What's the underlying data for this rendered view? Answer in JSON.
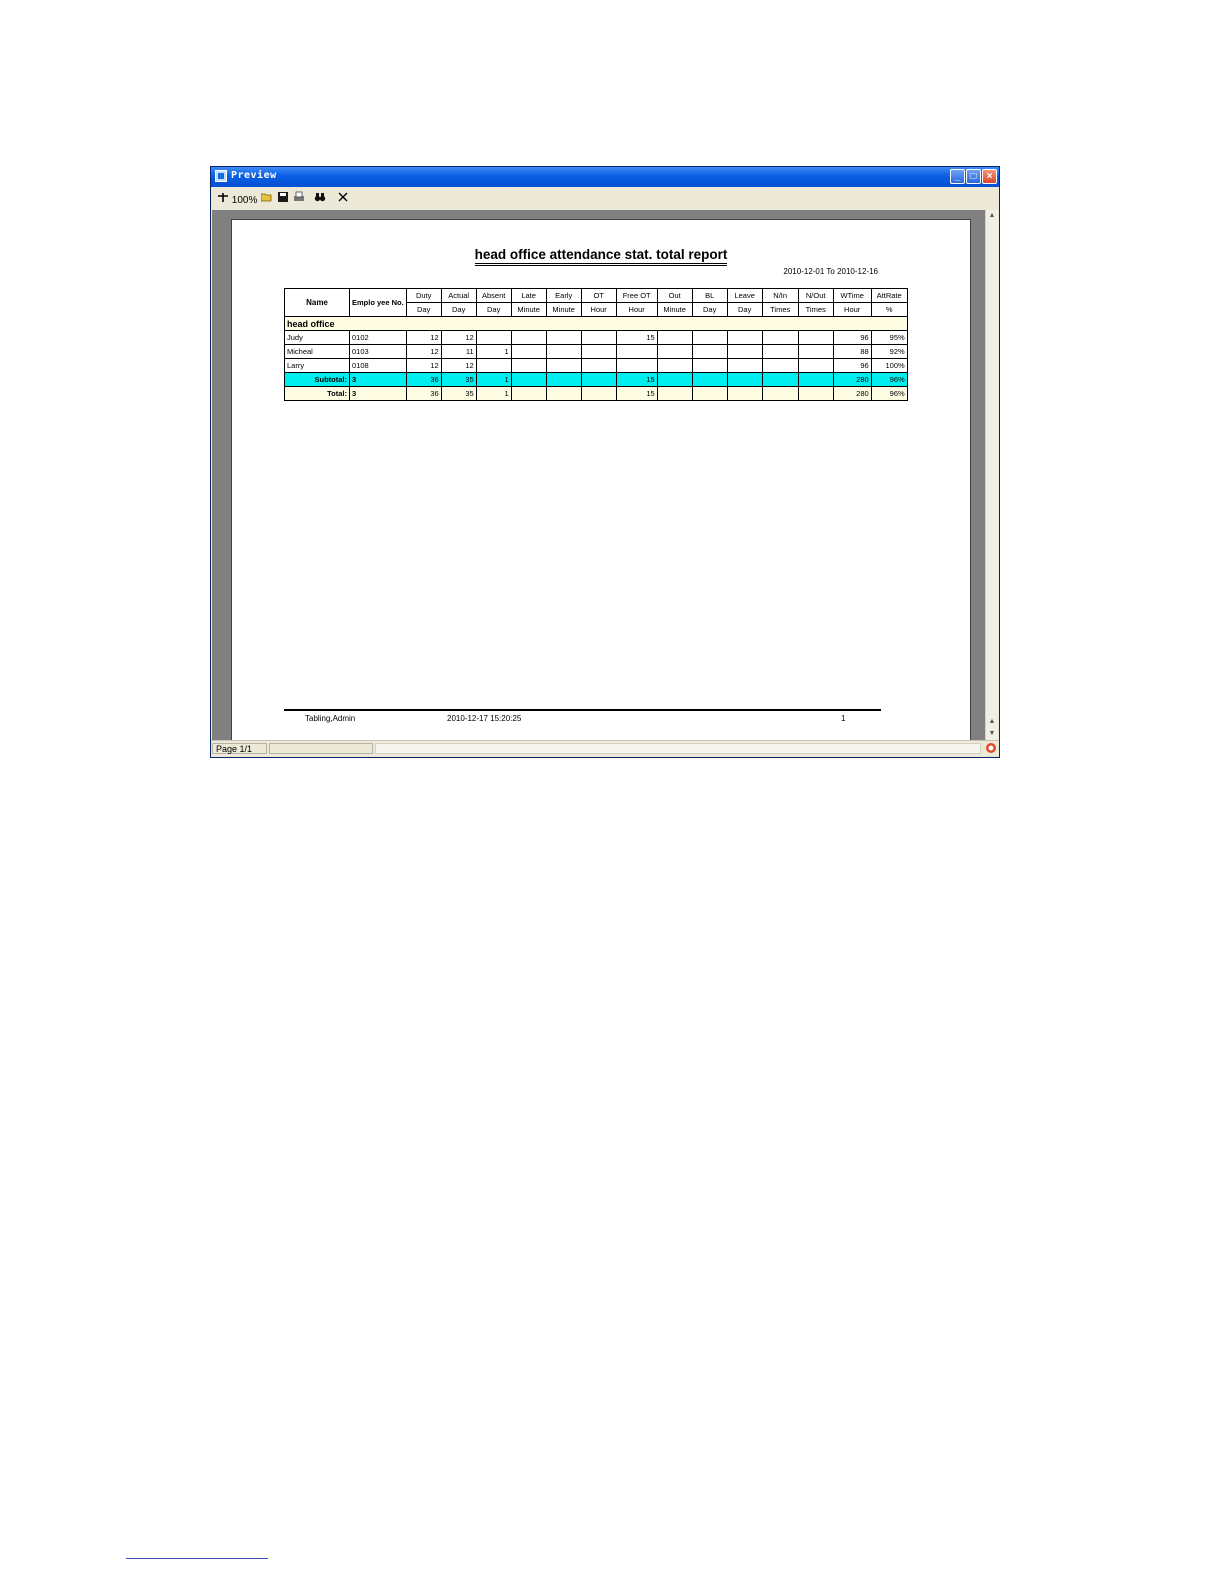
{
  "window": {
    "title": "Preview"
  },
  "toolbar": {
    "zoom_label": "100%"
  },
  "status": {
    "page": "Page 1/1"
  },
  "report": {
    "title": "head office attendance stat. total report",
    "date_range": "2010-12-01 To 2010-12-16",
    "header_top": [
      "Name",
      "Emplo yee No.",
      "Duty",
      "Actual",
      "Absent",
      "Late",
      "Early",
      "OT",
      "Free OT",
      "Out",
      "BL",
      "Leave",
      "N/In",
      "N/Out",
      "WTime",
      "AttRate"
    ],
    "header_units": [
      "Day",
      "Day",
      "Day",
      "Minute",
      "Minute",
      "Hour",
      "Hour",
      "Minute",
      "Day",
      "Day",
      "Times",
      "Times",
      "Hour",
      "%"
    ],
    "group": "head office",
    "rows": [
      {
        "name": "Judy",
        "no": "0102",
        "cells": [
          "12",
          "12",
          "",
          "",
          "",
          "",
          "15",
          "",
          "",
          "",
          "",
          "",
          "96",
          "95%"
        ]
      },
      {
        "name": "Micheal",
        "no": "0103",
        "cells": [
          "12",
          "11",
          "1",
          "",
          "",
          "",
          "",
          "",
          "",
          "",
          "",
          "",
          "88",
          "92%"
        ]
      },
      {
        "name": "Larry",
        "no": "0108",
        "cells": [
          "12",
          "12",
          "",
          "",
          "",
          "",
          "",
          "",
          "",
          "",
          "",
          "",
          "96",
          "100%"
        ]
      }
    ],
    "subtotal": {
      "label": "Subtotal:",
      "count": "3",
      "cells": [
        "36",
        "35",
        "1",
        "",
        "",
        "",
        "15",
        "",
        "",
        "",
        "",
        "",
        "280",
        "96%"
      ]
    },
    "total": {
      "label": "Total:",
      "count": "3",
      "cells": [
        "36",
        "35",
        "1",
        "",
        "",
        "",
        "15",
        "",
        "",
        "",
        "",
        "",
        "280",
        "96%"
      ]
    },
    "footer": {
      "user": "Tabling,Admin",
      "printed": "2010-12-17 15:20:25",
      "page": "1"
    }
  }
}
